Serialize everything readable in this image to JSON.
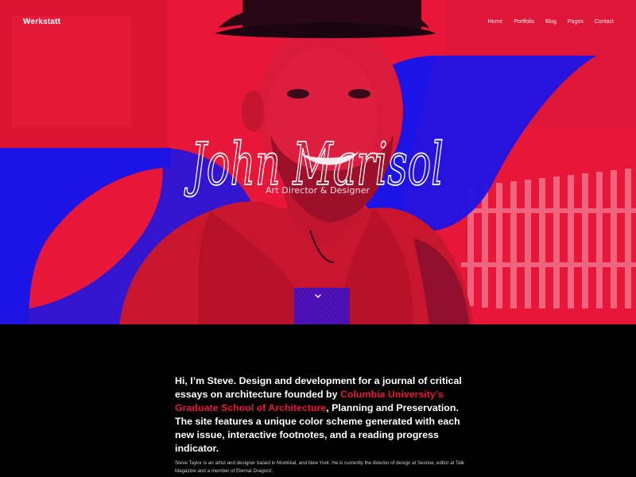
{
  "site": {
    "brand": "Werkstatt"
  },
  "nav": {
    "items": [
      {
        "label": "Home"
      },
      {
        "label": "Portfolio"
      },
      {
        "label": "Blog"
      },
      {
        "label": "Pages"
      },
      {
        "label": "Contact"
      }
    ]
  },
  "hero": {
    "signature": "John Marisol",
    "tagline": "Art Director & Designer",
    "scroll_icon": "chevron-down-icon"
  },
  "about": {
    "intro_part1": "Hi, I’m Steve. Design and development for a journal of critical essays on architecture founded by ",
    "intro_link": "Columbia University’s Graduate School of Architecture",
    "intro_part2": ", Planning and Preservation. The site features a unique color scheme generated with each new issue, interactive footnotes, and a reading progress indicator.",
    "bio": "Steve Taylor is an artist and designer based in Montréal, and New York. He is currently the director of design at Sesnse, editor at Talk Magazine and a member of Eternal Dragonz."
  },
  "colors": {
    "primary_red": "#e8173a",
    "accent_blue": "#1c13e6",
    "background": "#000000",
    "text": "#ffffff"
  }
}
